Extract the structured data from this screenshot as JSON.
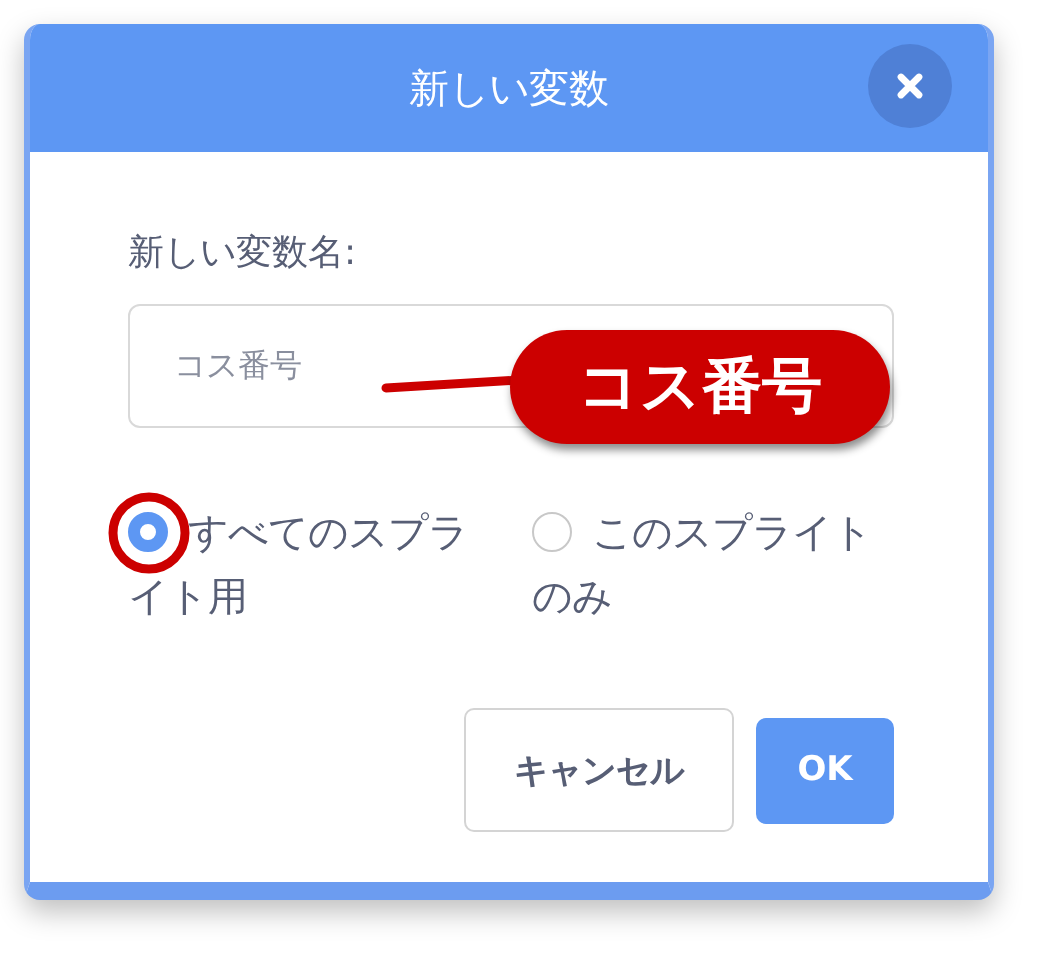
{
  "dialog": {
    "title": "新しい変数",
    "name_label": "新しい変数名:",
    "name_field": {
      "value": "コス番号"
    },
    "scope_options": [
      {
        "label": "すべてのスプライト用",
        "selected": true
      },
      {
        "label": "このスプライトのみ",
        "selected": false
      }
    ],
    "buttons": [
      {
        "label": "キャンセル",
        "kind": "secondary"
      },
      {
        "label": "OK",
        "kind": "primary"
      }
    ]
  },
  "annotations": [
    {
      "kind": "callout",
      "text": "コス番号"
    },
    {
      "kind": "ring"
    }
  ]
}
